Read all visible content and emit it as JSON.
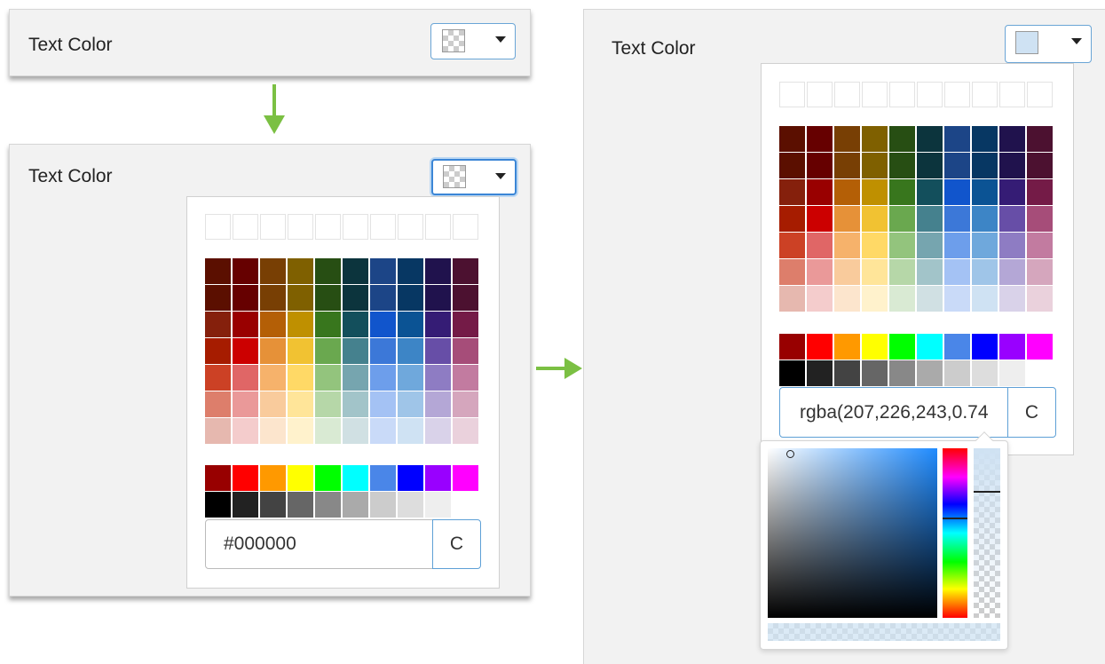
{
  "panel_a": {
    "label": "Text Color"
  },
  "panel_b": {
    "label": "Text Color",
    "hex_value": "#000000",
    "clear_label": "C"
  },
  "panel_c": {
    "label": "Text Color",
    "hex_value": "rgba(207,226,243,0.74",
    "clear_label": "C",
    "selected_color": "#cfe2f3"
  },
  "palette": {
    "main": [
      [
        "#5b0f00",
        "#660000",
        "#783f04",
        "#7f6000",
        "#274e13",
        "#0c343d",
        "#1c4587",
        "#073763",
        "#20124d",
        "#4c1130"
      ],
      [
        "#5b0f00",
        "#660000",
        "#783f04",
        "#7f6000",
        "#274e13",
        "#0c343d",
        "#1c4587",
        "#073763",
        "#20124d",
        "#4c1130"
      ],
      [
        "#85200c",
        "#990000",
        "#b45f06",
        "#bf9000",
        "#38761d",
        "#134f5c",
        "#1155cc",
        "#0b5394",
        "#351c75",
        "#741b47"
      ],
      [
        "#a61c00",
        "#cc0000",
        "#e69138",
        "#f1c232",
        "#6aa84f",
        "#45818e",
        "#3c78d8",
        "#3d85c6",
        "#674ea7",
        "#a64d79"
      ],
      [
        "#cc4125",
        "#e06666",
        "#f6b26b",
        "#ffd966",
        "#93c47d",
        "#76a5af",
        "#6d9eeb",
        "#6fa8dc",
        "#8e7cc3",
        "#c27ba0"
      ],
      [
        "#dd7e6b",
        "#ea9999",
        "#f9cb9c",
        "#ffe599",
        "#b6d7a8",
        "#a2c4c9",
        "#a4c2f4",
        "#9fc5e8",
        "#b4a7d6",
        "#d5a6bd"
      ],
      [
        "#e6b8af",
        "#f4cccc",
        "#fce5cd",
        "#fff2cc",
        "#d9ead3",
        "#d0e0e3",
        "#c9daf8",
        "#cfe2f3",
        "#d9d2e9",
        "#ead1dc"
      ]
    ],
    "bright": [
      "#980000",
      "#ff0000",
      "#ff9900",
      "#ffff00",
      "#00ff00",
      "#00ffff",
      "#4a86e8",
      "#0000ff",
      "#9900ff",
      "#ff00ff"
    ],
    "gray": [
      "#000000",
      "#222222",
      "#434343",
      "#666666",
      "#888888",
      "#aaaaaa",
      "#cccccc",
      "#dddddd",
      "#eeeeee",
      "#ffffff"
    ]
  }
}
